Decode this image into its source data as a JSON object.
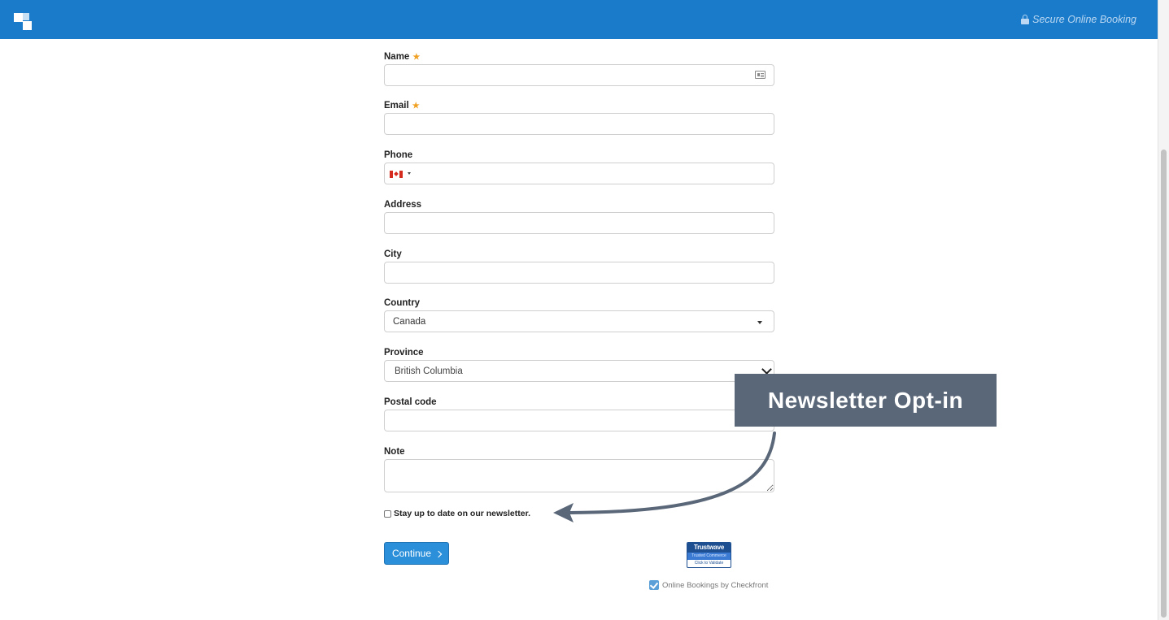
{
  "header": {
    "secure_label": "Secure Online Booking",
    "bg_color": "#1a7bca"
  },
  "form": {
    "name": {
      "label": "Name",
      "required": true,
      "value": ""
    },
    "email": {
      "label": "Email",
      "required": true,
      "value": ""
    },
    "phone": {
      "label": "Phone",
      "country_flag": "canada-flag-icon",
      "value": ""
    },
    "address": {
      "label": "Address",
      "value": ""
    },
    "city": {
      "label": "City",
      "value": ""
    },
    "country": {
      "label": "Country",
      "selected": "Canada"
    },
    "province": {
      "label": "Province",
      "selected": "British Columbia"
    },
    "postal_code": {
      "label": "Postal code",
      "value": ""
    },
    "note": {
      "label": "Note",
      "value": ""
    },
    "newsletter": {
      "label": "Stay up to date on our newsletter.",
      "checked": false
    },
    "continue_label": "Continue"
  },
  "trust_badge": {
    "brand": "Trustwave",
    "tagline": "Trusted Commerce",
    "action": "Click to Validate"
  },
  "footer": {
    "powered_by": "Online Bookings by Checkfront"
  },
  "annotation": {
    "callout_text": "Newsletter Opt-in",
    "color": "#5a6779"
  }
}
